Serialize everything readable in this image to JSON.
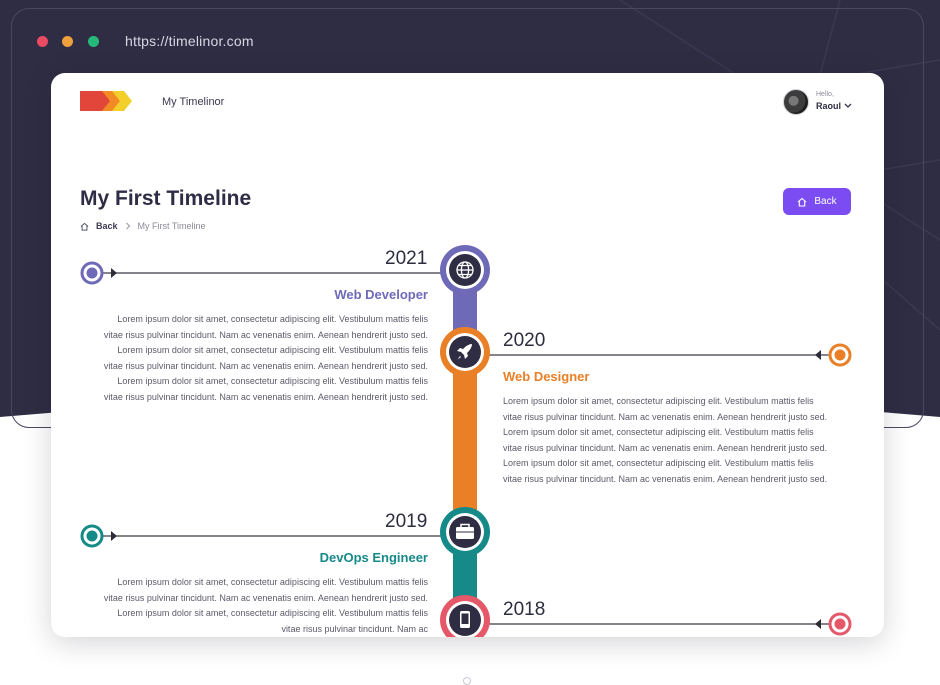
{
  "browser": {
    "url": "https://timelinor.com",
    "dots": [
      "#e94b63",
      "#efa23c",
      "#26b979"
    ]
  },
  "header": {
    "app_name": "My Timelinor",
    "greeting": "Hello,",
    "user_name": "Raoul"
  },
  "page": {
    "title": "My First Timeline",
    "back_button": "Back",
    "breadcrumb": [
      "Back",
      "My First Timeline"
    ]
  },
  "timeline": [
    {
      "year": "2021",
      "role": "Web Developer",
      "color": "#6f6ab8",
      "icon": "globe-icon",
      "side": "left",
      "description": "Lorem ipsum dolor sit amet, consectetur adipiscing elit. Vestibulum mattis felis vitae risus pulvinar tincidunt. Nam ac venenatis enim. Aenean hendrerit justo sed. Lorem ipsum dolor sit amet, consectetur adipiscing elit. Vestibulum mattis felis vitae risus pulvinar tincidunt. Nam ac venenatis enim. Aenean hendrerit justo sed. Lorem ipsum dolor sit amet, consectetur adipiscing elit. Vestibulum mattis felis vitae risus pulvinar tincidunt. Nam ac venenatis enim. Aenean hendrerit justo sed."
    },
    {
      "year": "2020",
      "role": "Web Designer",
      "color": "#e98028",
      "icon": "rocket-icon",
      "side": "right",
      "description": "Lorem ipsum dolor sit amet, consectetur adipiscing elit. Vestibulum mattis felis vitae risus pulvinar tincidunt. Nam ac venenatis enim. Aenean hendrerit justo sed. Lorem ipsum dolor sit amet, consectetur adipiscing elit. Vestibulum mattis felis vitae risus pulvinar tincidunt. Nam ac venenatis enim. Aenean hendrerit justo sed. Lorem ipsum dolor sit amet, consectetur adipiscing elit. Vestibulum mattis felis vitae risus pulvinar tincidunt. Nam ac venenatis enim. Aenean hendrerit justo sed."
    },
    {
      "year": "2019",
      "role": "DevOps Engineer",
      "color": "#168a88",
      "icon": "briefcase-icon",
      "side": "left",
      "description": "Lorem ipsum dolor sit amet, consectetur adipiscing elit. Vestibulum mattis felis vitae risus pulvinar tincidunt. Nam ac venenatis enim. Aenean hendrerit justo sed. Lorem ipsum dolor sit amet, consectetur adipiscing elit. Vestibulum mattis felis vitae risus pulvinar tincidunt. Nam ac"
    },
    {
      "year": "2018",
      "role": "",
      "color": "#e5586a",
      "icon": "smartphone-icon",
      "side": "right",
      "description": ""
    }
  ]
}
